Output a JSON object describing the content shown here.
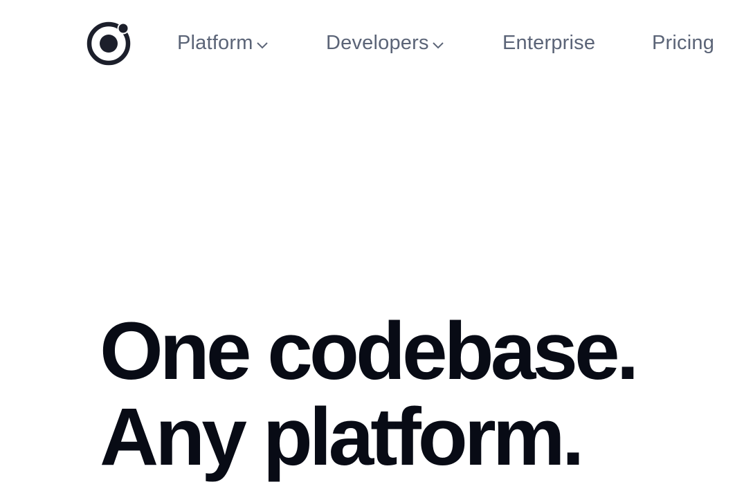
{
  "header": {
    "logo_icon": "ionic-logo-icon",
    "nav": [
      {
        "label": "Platform",
        "has_dropdown": true,
        "dropdown_icon": "chevron-down-icon"
      },
      {
        "label": "Developers",
        "has_dropdown": true,
        "dropdown_icon": "chevron-down-icon"
      },
      {
        "label": "Enterprise",
        "has_dropdown": false
      },
      {
        "label": "Pricing",
        "has_dropdown": false
      }
    ]
  },
  "hero": {
    "headline_line1": "One codebase.",
    "headline_line2": "Any platform."
  },
  "colors": {
    "background": "#ffffff",
    "nav_text": "#5b6477",
    "headline": "#080b15",
    "logo": "#1c1f2b"
  }
}
